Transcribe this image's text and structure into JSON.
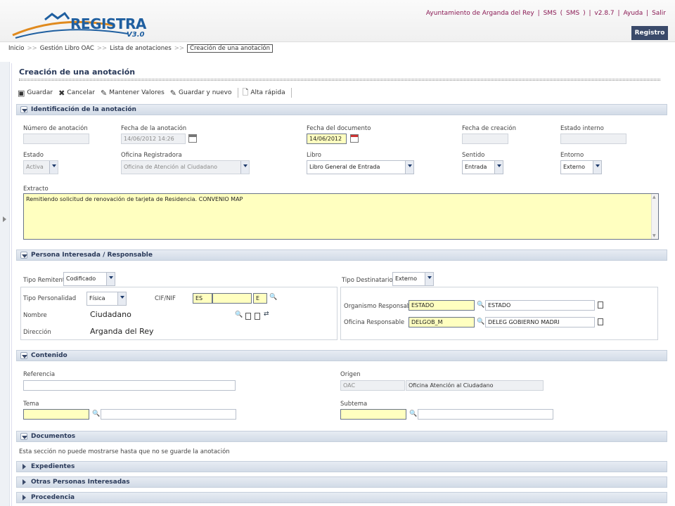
{
  "header": {
    "logo_text": "REGISTRA",
    "logo_version": "V3.0",
    "links": [
      "Ayuntamiento de Arganda del Rey",
      "|",
      "SMS",
      "(",
      "SMS",
      ")",
      "|",
      "v2.8.7",
      "|",
      "Ayuda",
      "|",
      "Salir"
    ],
    "registro_button": "Registro"
  },
  "breadcrumb": {
    "items": [
      "Inicio",
      "Gestión Libro OAC",
      "Lista de anotaciones"
    ],
    "separator": ">>",
    "current": "Creación de una anotación"
  },
  "page_title": "Creación de una anotación",
  "toolbar": {
    "guardar": "Guardar",
    "cancelar": "Cancelar",
    "mantener": "Mantener Valores",
    "guardar_nuevo": "Guardar y nuevo",
    "alta_rapida": "Alta rápida"
  },
  "identificacion": {
    "header": "Identificación de la anotación",
    "numero_label": "Número de anotación",
    "numero_value": "",
    "fecha_anotacion_label": "Fecha de la anotación",
    "fecha_anotacion_value": "14/06/2012 14:26",
    "fecha_documento_label": "Fecha del documento",
    "fecha_documento_value": "14/06/2012",
    "fecha_creacion_label": "Fecha de creación",
    "fecha_creacion_value": "",
    "estado_interno_label": "Estado interno",
    "estado_interno_value": "",
    "estado_label": "Estado",
    "estado_value": "Activa",
    "oficina_label": "Oficina Registradora",
    "oficina_value": "Oficina de Atención al Ciudadano",
    "libro_label": "Libro",
    "libro_value": "Libro General de Entrada",
    "sentido_label": "Sentido",
    "sentido_value": "Entrada",
    "entorno_label": "Entorno",
    "entorno_value": "Externo",
    "extracto_label": "Extracto",
    "extracto_value": "Remitiendo solicitud de renovación de tarjeta de Residencia. CONVENIO MAP"
  },
  "persona": {
    "header": "Persona Interesada / Responsable",
    "tipo_remitente_label": "Tipo Remitente",
    "tipo_remitente_value": "Codificado",
    "tipo_destinatario_label": "Tipo Destinatario/a",
    "tipo_destinatario_value": "Externo",
    "tipo_personalidad_label": "Tipo Personalidad",
    "tipo_personalidad_value": "Física",
    "cif_label": "CIF/NIF",
    "cif_prefix": "ES",
    "cif_value": "",
    "cif_letter": "E",
    "nombre_label": "Nombre",
    "nombre_value": "Ciudadano",
    "direccion_label": "Dirección",
    "direccion_value": "Arganda del Rey",
    "organismo_label": "Organismo Responsable",
    "organismo_code": "ESTADO",
    "organismo_name": "ESTADO",
    "oficina_resp_label": "Oficina Responsable",
    "oficina_resp_code": "DELGOB_M",
    "oficina_resp_name": "DELEG GOBIERNO MADRI"
  },
  "contenido": {
    "header": "Contenido",
    "referencia_label": "Referencia",
    "referencia_value": "",
    "origen_label": "Origen",
    "origen_code": "OAC",
    "origen_name": "Oficina Atención al Ciudadano",
    "tema_label": "Tema",
    "subtema_label": "Subtema"
  },
  "documentos": {
    "header": "Documentos",
    "note": "Esta sección no puede mostrarse hasta que no se guarde la anotación"
  },
  "collapsed_sections": [
    "Expedientes",
    "Otras Personas Interesadas",
    "Procedencia"
  ]
}
